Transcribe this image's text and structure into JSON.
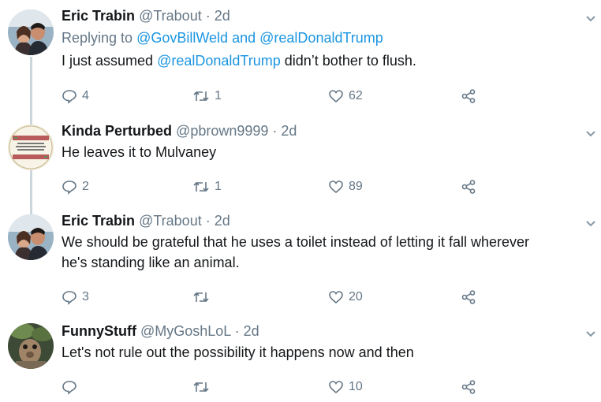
{
  "tweets": [
    {
      "name": "Eric Trabin",
      "handle": "@Trabout",
      "time": "· 2d",
      "replying_prefix": "Replying to",
      "replying_user1": "@GovBillWeld",
      "replying_and": "and",
      "replying_user2": "@realDonaldTrump",
      "text_pre": "I just assumed",
      "text_mention": "@realDonaldTrump",
      "text_post": "didn’t bother to flush.",
      "replies": "4",
      "retweets": "1",
      "likes": "62"
    },
    {
      "name": "Kinda Perturbed",
      "handle": "@pbrown9999",
      "time": "· 2d",
      "text": "He leaves it to Mulvaney",
      "replies": "2",
      "retweets": "1",
      "likes": "89"
    },
    {
      "name": "Eric Trabin",
      "handle": "@Trabout",
      "time": "· 2d",
      "text_line1": "We should be grateful that he uses a toilet instead of letting it fall wherever",
      "text_line2": "he's standing like an animal.",
      "replies": "3",
      "retweets": "",
      "likes": "20"
    },
    {
      "name": "FunnyStuff",
      "handle": "@MyGoshLoL",
      "time": "· 2d",
      "text": "Let's not rule out the possibility it happens now and then",
      "replies": "",
      "retweets": "",
      "likes": "10"
    }
  ],
  "icons": {
    "reply": "reply-icon",
    "retweet": "retweet-icon",
    "like": "heart-icon",
    "share": "share-icon",
    "more": "chevron-down-icon"
  },
  "colors": {
    "link": "#1b95e0",
    "muted": "#657786",
    "thread_line": "#ccd6dd"
  }
}
